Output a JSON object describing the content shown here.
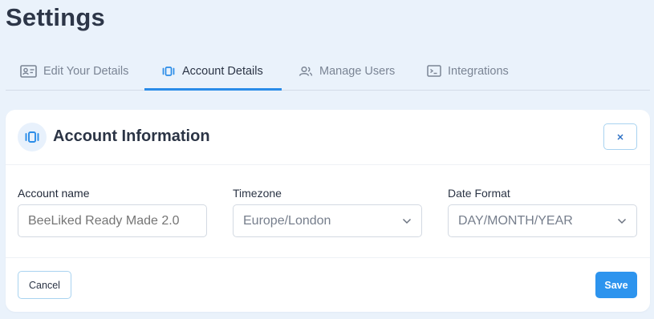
{
  "page": {
    "title": "Settings"
  },
  "tabs": [
    {
      "label": "Edit Your Details",
      "icon": "id-card-icon",
      "active": false
    },
    {
      "label": "Account Details",
      "icon": "account-icon",
      "active": true
    },
    {
      "label": "Manage Users",
      "icon": "users-icon",
      "active": false
    },
    {
      "label": "Integrations",
      "icon": "terminal-icon",
      "active": false
    }
  ],
  "card": {
    "title": "Account Information",
    "icon": "account-icon",
    "close_icon": "close-icon"
  },
  "form": {
    "account_name": {
      "label": "Account name",
      "placeholder": "BeeLiked Ready Made 2.0"
    },
    "timezone": {
      "label": "Timezone",
      "value": "Europe/London"
    },
    "date_format": {
      "label": "Date Format",
      "value": "DAY/MONTH/YEAR"
    }
  },
  "footer": {
    "cancel_label": "Cancel",
    "save_label": "Save"
  },
  "colors": {
    "accent": "#2d94ee",
    "background": "#eaf2fb",
    "text": "#2b3445"
  }
}
